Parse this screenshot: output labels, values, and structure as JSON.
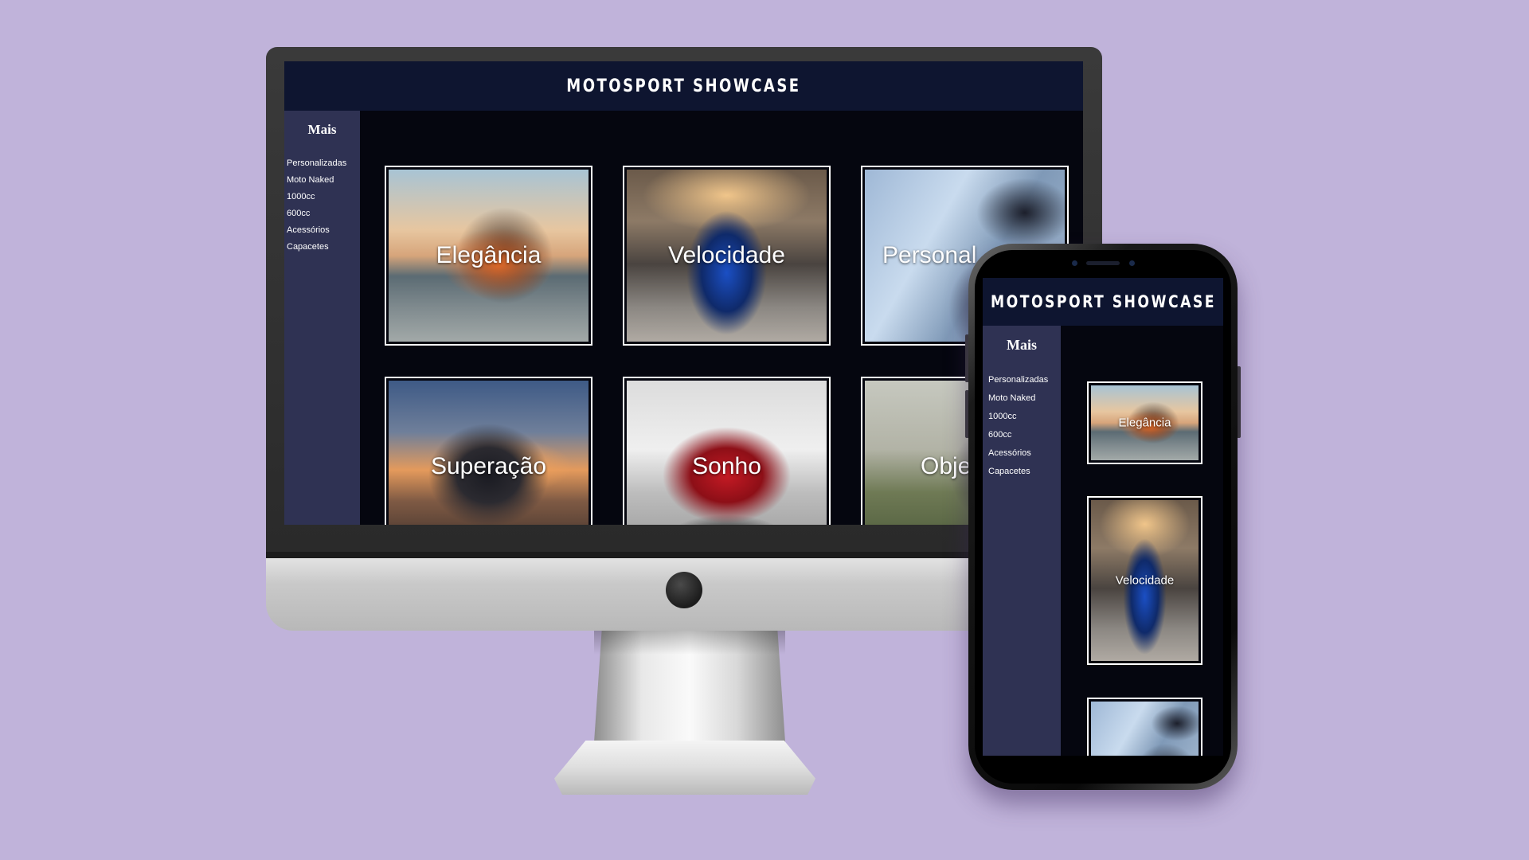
{
  "site": {
    "title": "MOTOSPORT SHOWCASE"
  },
  "sidebar": {
    "heading": "Mais",
    "items": [
      {
        "label": "Personalizadas"
      },
      {
        "label": "Moto Naked"
      },
      {
        "label": "1000cc"
      },
      {
        "label": "600cc"
      },
      {
        "label": "Acessórios"
      },
      {
        "label": "Capacetes"
      }
    ]
  },
  "desktop_gallery": [
    {
      "label": "Elegância"
    },
    {
      "label": "Velocidade"
    },
    {
      "label": "Personal"
    },
    {
      "label": "Superação"
    },
    {
      "label": "Sonho"
    },
    {
      "label": "Obje"
    }
  ],
  "mobile_gallery": [
    {
      "label": "Elegância"
    },
    {
      "label": "Velocidade"
    },
    {
      "label": ""
    }
  ],
  "colors": {
    "background": "#c0b3da",
    "header": "#0e1530",
    "sidebar": "#2f3253",
    "content": "#05060f",
    "text": "#ffffff"
  }
}
